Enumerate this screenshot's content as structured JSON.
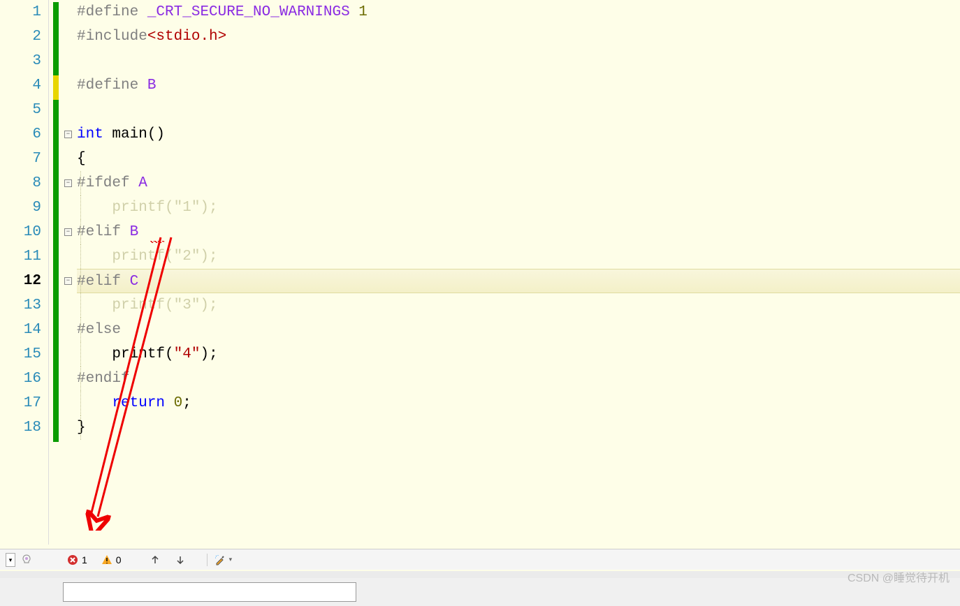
{
  "code": {
    "lines": [
      {
        "num": "1",
        "tokens": [
          {
            "t": "#define ",
            "c": "gray"
          },
          {
            "t": "_CRT_SECURE_NO_WARNINGS",
            "c": "purple"
          },
          {
            "t": " ",
            "c": "black"
          },
          {
            "t": "1",
            "c": "olive"
          }
        ]
      },
      {
        "num": "2",
        "tokens": [
          {
            "t": "#include",
            "c": "gray"
          },
          {
            "t": "<stdio.h>",
            "c": "red"
          }
        ]
      },
      {
        "num": "3",
        "tokens": []
      },
      {
        "num": "4",
        "tokens": [
          {
            "t": "#define ",
            "c": "gray"
          },
          {
            "t": "B",
            "c": "purple"
          }
        ]
      },
      {
        "num": "5",
        "tokens": []
      },
      {
        "num": "6",
        "fold": true,
        "tokens": [
          {
            "t": "int",
            "c": "blue"
          },
          {
            "t": " main()",
            "c": "black"
          }
        ]
      },
      {
        "num": "7",
        "tokens": [
          {
            "t": "{",
            "c": "black"
          }
        ]
      },
      {
        "num": "8",
        "fold": true,
        "tokens": [
          {
            "t": "#ifdef ",
            "c": "gray"
          },
          {
            "t": "A",
            "c": "purple"
          }
        ]
      },
      {
        "num": "9",
        "dim": true,
        "tokens": [
          {
            "t": "    printf(\"1\");",
            "c": "dim"
          }
        ]
      },
      {
        "num": "10",
        "fold": true,
        "tokens": [
          {
            "t": "#elif ",
            "c": "gray"
          },
          {
            "t": "B",
            "c": "purple"
          }
        ],
        "error": true
      },
      {
        "num": "11",
        "dim": true,
        "tokens": [
          {
            "t": "    printf(\"2\");",
            "c": "dim"
          }
        ]
      },
      {
        "num": "12",
        "fold": true,
        "current": true,
        "tokens": [
          {
            "t": "#elif ",
            "c": "gray"
          },
          {
            "t": "C",
            "c": "purple"
          }
        ]
      },
      {
        "num": "13",
        "dim": true,
        "tokens": [
          {
            "t": "    printf(\"3\");",
            "c": "dim"
          }
        ]
      },
      {
        "num": "14",
        "tokens": [
          {
            "t": "#else",
            "c": "gray"
          }
        ]
      },
      {
        "num": "15",
        "tokens": [
          {
            "t": "    printf",
            "c": "black"
          },
          {
            "t": "(",
            "c": "black"
          },
          {
            "t": "\"4\"",
            "c": "red"
          },
          {
            "t": ")",
            "c": "black"
          },
          {
            "t": ";",
            "c": "black"
          }
        ]
      },
      {
        "num": "16",
        "tokens": [
          {
            "t": "#endif",
            "c": "gray"
          }
        ]
      },
      {
        "num": "17",
        "tokens": [
          {
            "t": "    ",
            "c": "black"
          },
          {
            "t": "return",
            "c": "blue"
          },
          {
            "t": " ",
            "c": "black"
          },
          {
            "t": "0",
            "c": "olive"
          },
          {
            "t": ";",
            "c": "black"
          }
        ]
      },
      {
        "num": "18",
        "tokens": [
          {
            "t": "}",
            "c": "black"
          }
        ]
      }
    ]
  },
  "status": {
    "errors": "1",
    "warnings": "0"
  },
  "watermark": "CSDN @睡觉待开机"
}
